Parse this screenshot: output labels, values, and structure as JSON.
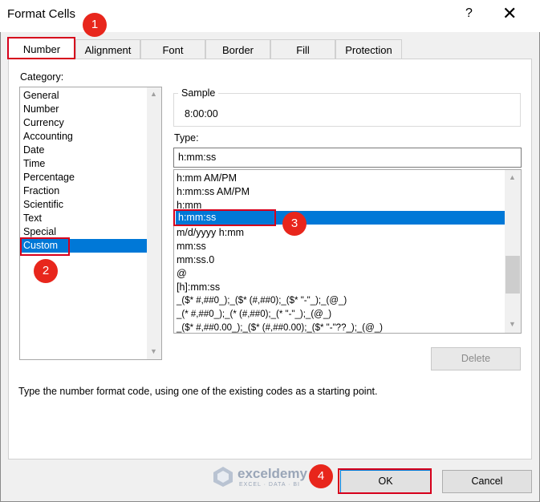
{
  "window": {
    "title": "Format Cells",
    "help": "?",
    "close": "✕"
  },
  "tabs": [
    {
      "label": "Number"
    },
    {
      "label": "Alignment"
    },
    {
      "label": "Font"
    },
    {
      "label": "Border"
    },
    {
      "label": "Fill"
    },
    {
      "label": "Protection"
    }
  ],
  "category": {
    "label": "Category:",
    "items": [
      "General",
      "Number",
      "Currency",
      "Accounting",
      "Date",
      "Time",
      "Percentage",
      "Fraction",
      "Scientific",
      "Text",
      "Special",
      "Custom"
    ],
    "selected": "Custom"
  },
  "sample": {
    "label": "Sample",
    "value": "8:00:00"
  },
  "type": {
    "label": "Type:",
    "value": "h:mm:ss",
    "formats": [
      "h:mm AM/PM",
      "h:mm:ss AM/PM",
      "h:mm",
      "h:mm:ss",
      "m/d/yyyy h:mm",
      "mm:ss",
      "mm:ss.0",
      "@",
      "[h]:mm:ss",
      "_($* #,##0_);_($* (#,##0);_($* \"-\"_);_(@_)",
      "_(* #,##0_);_(* (#,##0);_(* \"-\"_);_(@_)",
      "_($* #,##0.00_);_($* (#,##0.00);_($* \"-\"??_);_(@_)"
    ],
    "selected": "h:mm:ss"
  },
  "buttons": {
    "delete": "Delete",
    "ok": "OK",
    "cancel": "Cancel"
  },
  "hint": "Type the number format code, using one of the existing codes as a starting point.",
  "steps": [
    "1",
    "2",
    "3",
    "4"
  ],
  "watermark": {
    "name": "exceldemy",
    "tagline": "EXCEL · DATA · BI"
  },
  "colors": {
    "selection": "#0078d7",
    "highlight": "#d6001c",
    "badge": "#e8261c"
  },
  "icons": {
    "scroll_up": "chevron-up-icon",
    "scroll_down": "chevron-down-icon"
  }
}
